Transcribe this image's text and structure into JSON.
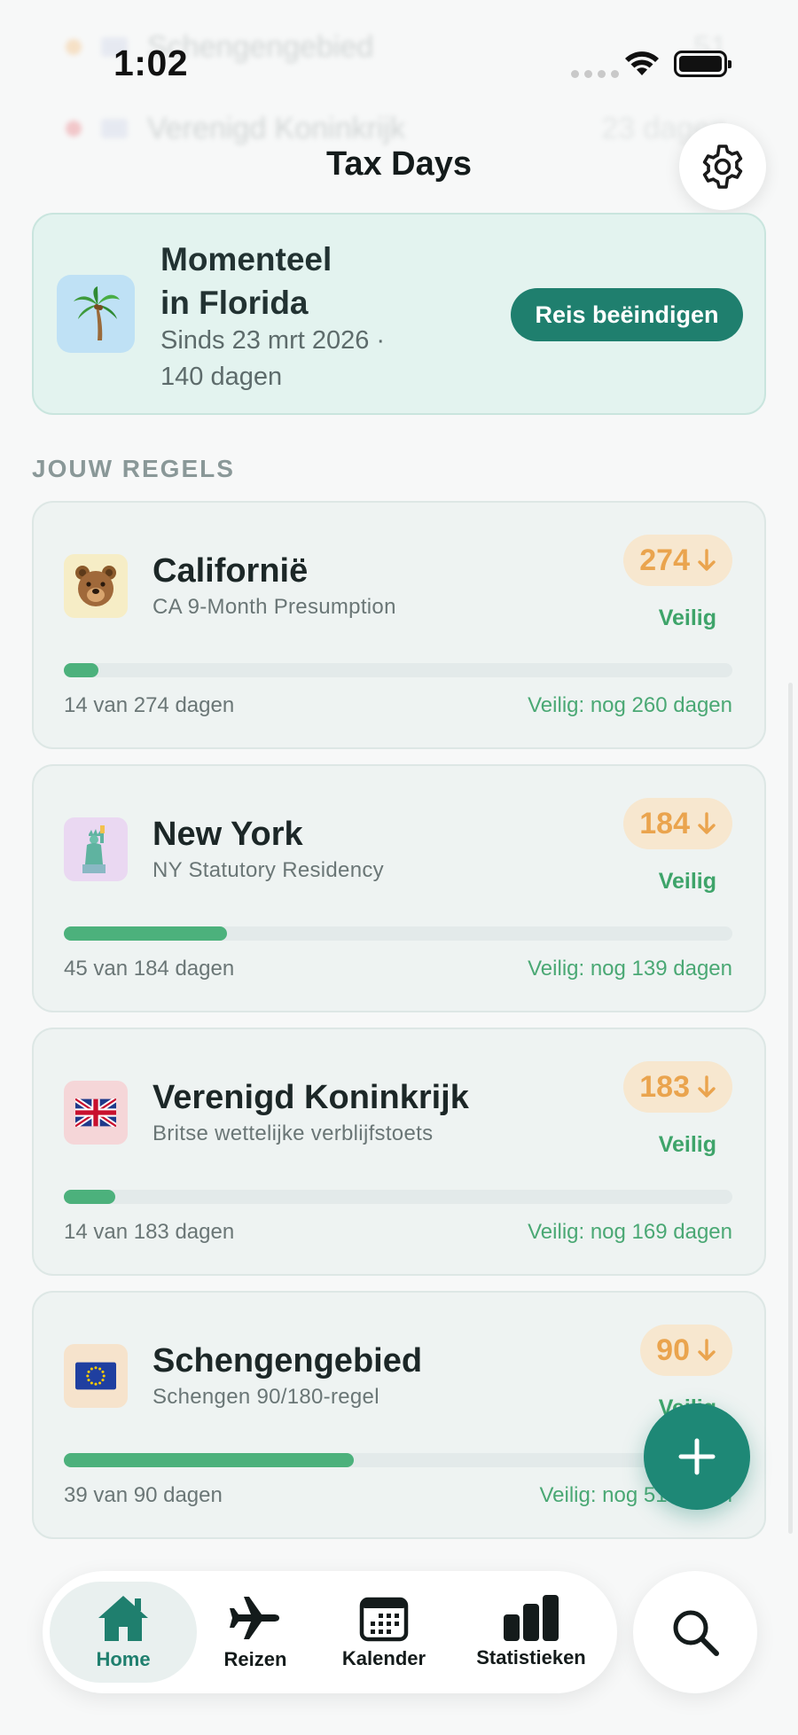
{
  "status_bar": {
    "time": "1:02"
  },
  "background_rows": [
    {
      "name": "Schengengebied",
      "value": "51",
      "dot_color": "#f4b66a"
    },
    {
      "name": "Verenigd Koninkrijk",
      "value": "23 dagen",
      "dot_color": "#e86c74"
    }
  ],
  "header": {
    "title": "Tax Days",
    "settings_icon": "gear-icon"
  },
  "current_trip": {
    "title_line1": "Momenteel",
    "title_line2": "in Florida",
    "subtitle_line1": "Sinds 23 mrt 2026 ·",
    "subtitle_line2": "140 dagen",
    "icon": "palm-tree-icon",
    "end_button": "Reis beëindigen"
  },
  "section_title": "JOUW REGELS",
  "rules": [
    {
      "name": "Californië",
      "description": "CA 9-Month Presumption",
      "icon": "bear-icon",
      "icon_bg": "#f6edc6",
      "limit": "274",
      "status": "Veilig",
      "used": 14,
      "total": 274,
      "used_text": "14 van 274 dagen",
      "remaining_text": "Veilig: nog 260 dagen"
    },
    {
      "name": "New York",
      "description": "NY Statutory Residency",
      "icon": "statue-of-liberty-icon",
      "icon_bg": "#ead8f2",
      "limit": "184",
      "status": "Veilig",
      "used": 45,
      "total": 184,
      "used_text": "45 van 184 dagen",
      "remaining_text": "Veilig: nog 139 dagen"
    },
    {
      "name": "Verenigd Koninkrijk",
      "description": "Britse wettelijke verblijfstoets",
      "icon": "uk-flag-icon",
      "icon_bg": "#f5d6d8",
      "limit": "183",
      "status": "Veilig",
      "used": 14,
      "total": 183,
      "used_text": "14 van 183 dagen",
      "remaining_text": "Veilig: nog 169 dagen"
    },
    {
      "name": "Schengengebied",
      "description": "Schengen 90/180-regel",
      "icon": "eu-flag-icon",
      "icon_bg": "#f6e3cc",
      "limit": "90",
      "status": "Veilig",
      "used": 39,
      "total": 90,
      "used_text": "39 van 90 dagen",
      "remaining_text": "Veilig: nog 51 dagen"
    }
  ],
  "fab": {
    "icon": "plus-icon"
  },
  "tab_bar": {
    "tabs": [
      {
        "label": "Home",
        "icon": "home-icon",
        "active": true
      },
      {
        "label": "Reizen",
        "icon": "airplane-icon",
        "active": false
      },
      {
        "label": "Kalender",
        "icon": "calendar-icon",
        "active": false
      },
      {
        "label": "Statistieken",
        "icon": "bar-chart-icon",
        "active": false
      }
    ],
    "search_icon": "search-icon"
  },
  "colors": {
    "accent": "#1f7f6e",
    "safe_green": "#4cb17c",
    "badge_orange": "#eaa44e",
    "badge_bg": "#f7e7cf",
    "current_card_bg": "#e3f3ef"
  }
}
